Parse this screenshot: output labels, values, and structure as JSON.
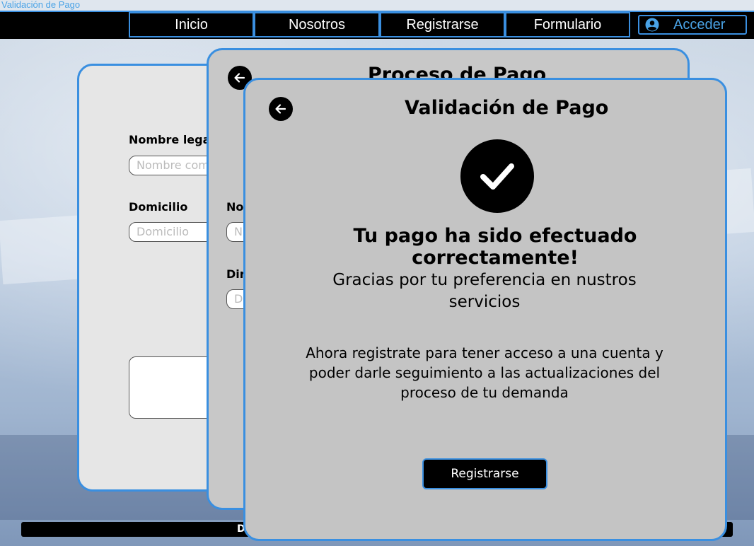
{
  "window": {
    "title": "Validación de Pago"
  },
  "navbar": {
    "items": [
      {
        "label": "Inicio"
      },
      {
        "label": "Nosotros"
      },
      {
        "label": "Registrarse"
      },
      {
        "label": "Formulario"
      }
    ],
    "login_label": "Acceder"
  },
  "form_card": {
    "name_label": "Nombre legal",
    "name_placeholder": "Nombre com",
    "address_label": "Domicilio",
    "address_placeholder": "Domicilio"
  },
  "payment_card": {
    "title": "Proceso de Pago",
    "label_no": "No",
    "input_n": "N",
    "label_dir": "Dir",
    "input_d": "D"
  },
  "validation_card": {
    "title": "Validación de Pago",
    "heading": "Tu pago ha sido efectuado correctamente!",
    "subheading": "Gracias por tu preferencia en nustros servicios",
    "body": "Ahora registrate para tener acceso a una cuenta y poder darle seguimiento a las actualizaciones del proceso de tu demanda",
    "register_button": "Registrarse"
  },
  "footer": {
    "text": "D"
  },
  "colors": {
    "accent": "#3a8fe0",
    "card_bg": "#c4c4c4",
    "dark": "#000000"
  },
  "icons": [
    "user-circle-icon",
    "arrow-left-icon",
    "check-icon"
  ]
}
